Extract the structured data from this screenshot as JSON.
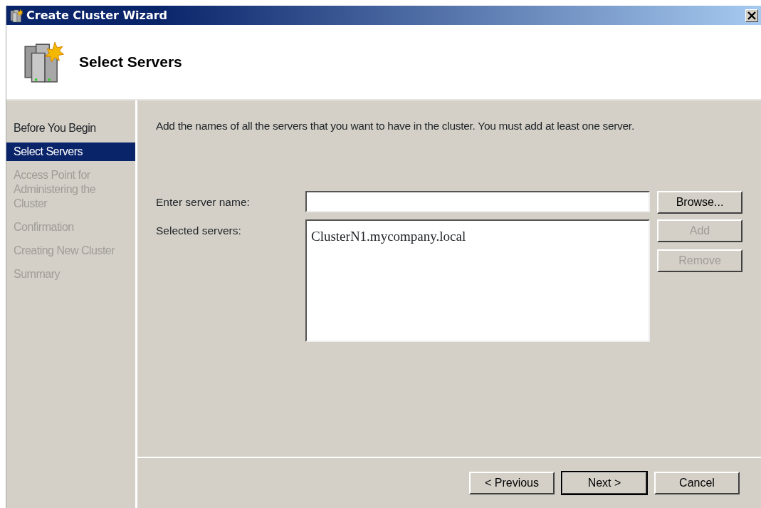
{
  "window": {
    "title": "Create Cluster Wizard"
  },
  "header": {
    "title": "Select Servers"
  },
  "steps": [
    {
      "label": "Before You Begin",
      "selected": false,
      "disabled": false
    },
    {
      "label": "Select Servers",
      "selected": true,
      "disabled": false
    },
    {
      "label": "Access Point for Administering the Cluster",
      "selected": false,
      "disabled": true
    },
    {
      "label": "Confirmation",
      "selected": false,
      "disabled": true
    },
    {
      "label": "Creating New Cluster",
      "selected": false,
      "disabled": true
    },
    {
      "label": "Summary",
      "selected": false,
      "disabled": true
    }
  ],
  "instruction": "Add the names of all the servers that you want to have in the cluster. You must add at least one server.",
  "server_name": {
    "label": "Enter server name:",
    "button": {
      "label": "Browse...",
      "disabled": false
    }
  },
  "selected_servers": {
    "label": "Selected servers:",
    "items": [
      "ClusterN1.mycompany.local"
    ],
    "buttons": [
      {
        "label": "Add",
        "disabled": true
      },
      {
        "label": "Remove",
        "disabled": true
      }
    ]
  },
  "footer_buttons": [
    {
      "label": "< Previous",
      "default": false
    },
    {
      "label": "Next >",
      "default": true
    },
    {
      "label": "Cancel",
      "default": false
    }
  ]
}
